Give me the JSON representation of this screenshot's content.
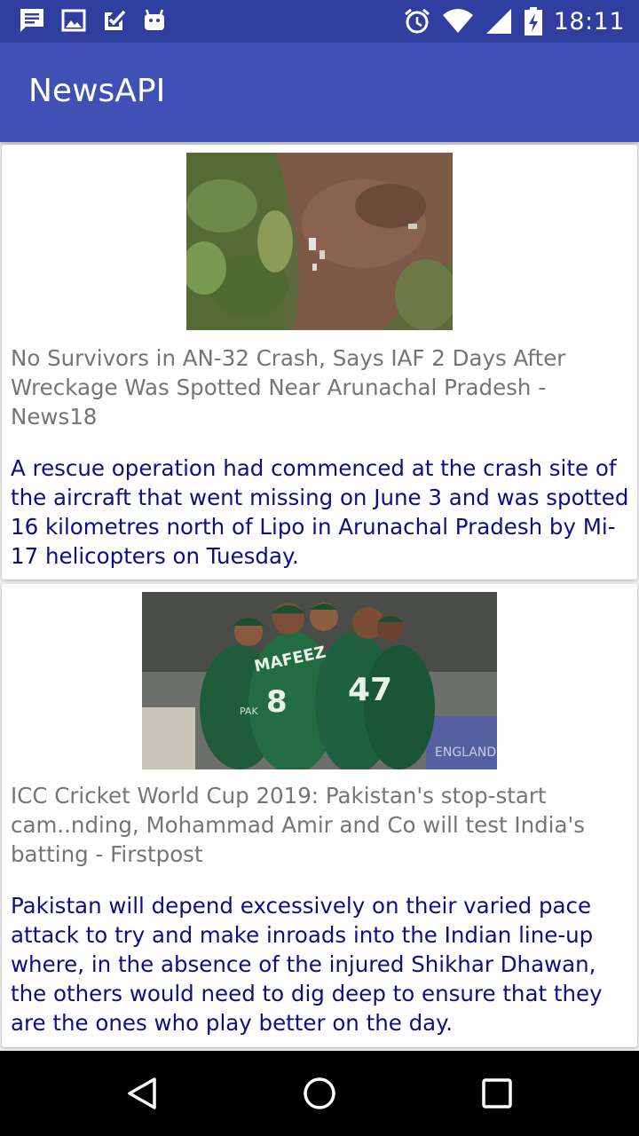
{
  "status_bar": {
    "time": "18:11",
    "icons": [
      "message-icon",
      "image-icon",
      "check-icon",
      "android-icon",
      "alarm-icon",
      "wifi-icon",
      "signal-icon",
      "battery-charging-icon"
    ]
  },
  "app_bar": {
    "title": "NewsAPI"
  },
  "articles": [
    {
      "title": "No Survivors in AN-32 Crash, Says IAF 2 Days After Wreckage Was Spotted Near Arunachal Pradesh - News18",
      "description": "A rescue operation had commenced at the crash site of the aircraft that went missing on June 3 and was spotted 16 kilometres north of Lipo in Arunachal Pradesh by Mi-17 helicopters on Tuesday.",
      "image": "crash-site-aerial-photo"
    },
    {
      "title": "ICC Cricket World Cup 2019: Pakistan's stop-start cam..nding, Mohammad Amir and Co will test India's batting - Firstpost",
      "description": "Pakistan will depend excessively on their varied pace attack to try and make inroads into the Indian line-up where, in the absence of the injured Shikhar Dhawan, the others would need to dig deep to ensure that they are the ones who play better on the day.",
      "image": "pakistan-team-celebration-photo",
      "image_text": [
        "MAFEEZ",
        "8",
        "47",
        "PAK",
        "ENGLAND"
      ]
    }
  ],
  "nav_bar": {
    "icons": [
      "back-icon",
      "home-icon",
      "recent-apps-icon"
    ]
  },
  "colors": {
    "status_bar": "#303f9f",
    "app_bar": "#3f51b5",
    "title_text": "#757575",
    "description_text": "#0d0d8a",
    "background": "#eeeeee"
  }
}
